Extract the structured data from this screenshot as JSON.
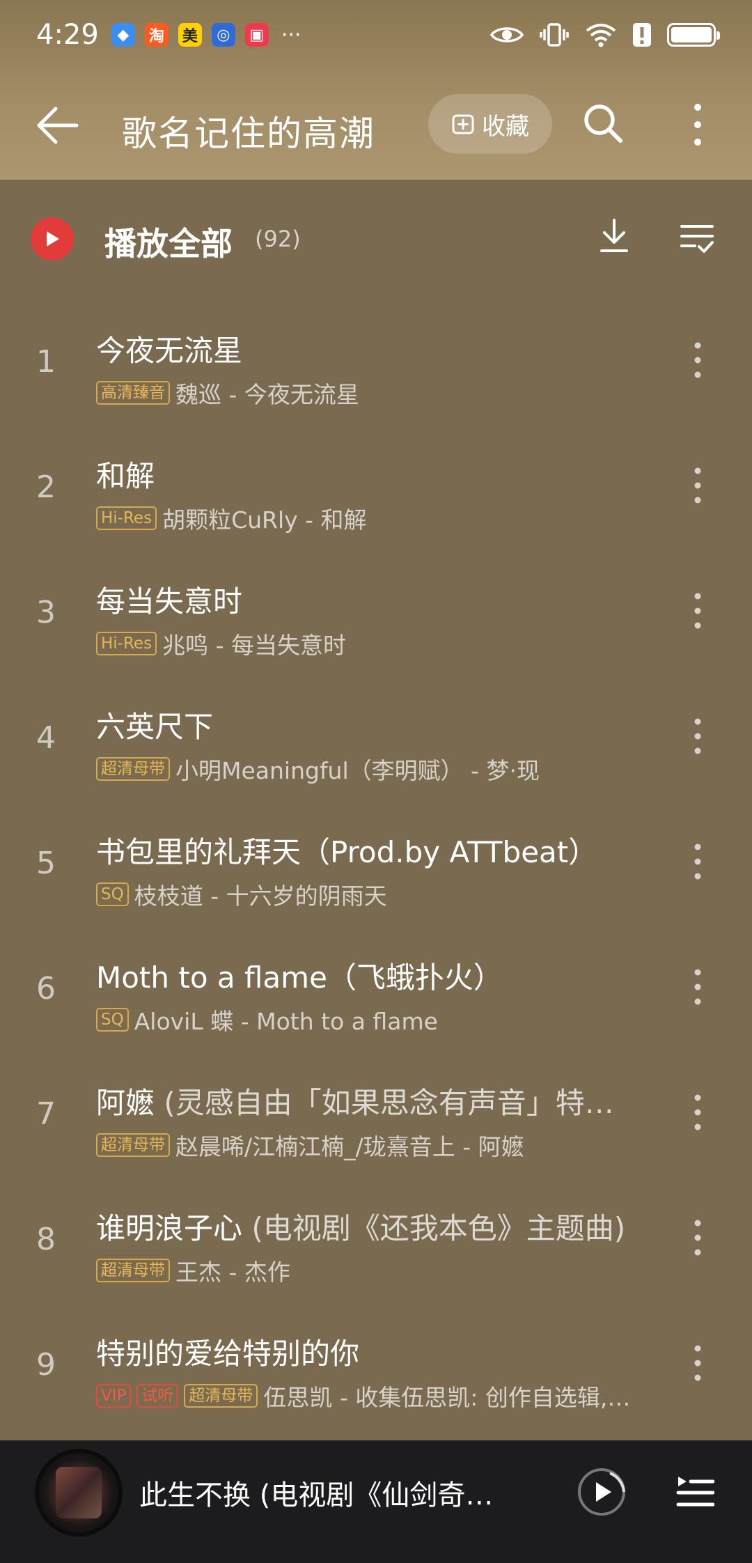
{
  "status_bar": {
    "time": "4:29",
    "notifications": [
      {
        "icon": "app-icon-blue",
        "color": "#3b8ef0",
        "glyph": "◆"
      },
      {
        "icon": "taobao-icon",
        "color": "#ff5a1f",
        "glyph": "淘"
      },
      {
        "icon": "meituan-icon",
        "color": "#ffd100",
        "glyph": "美"
      },
      {
        "icon": "app-icon-lightbulb",
        "color": "#2f6bd8",
        "glyph": "◎"
      },
      {
        "icon": "app-icon-red",
        "color": "#ee3a4a",
        "glyph": "▣"
      }
    ],
    "more": "···"
  },
  "header": {
    "title": "歌名记住的高潮",
    "favorite_label": "收藏"
  },
  "play_all": {
    "label": "播放全部",
    "count": "(92)"
  },
  "songs": [
    {
      "num": "1",
      "title": "今夜无流星",
      "title_sub": "",
      "badges": [
        {
          "text": "高清臻音",
          "kind": "quality"
        }
      ],
      "meta": "魏巡 - 今夜无流星"
    },
    {
      "num": "2",
      "title": "和解",
      "title_sub": "",
      "badges": [
        {
          "text": "Hi-Res",
          "kind": "quality"
        }
      ],
      "meta": "胡颗粒CuRly - 和解"
    },
    {
      "num": "3",
      "title": "每当失意时",
      "title_sub": "",
      "badges": [
        {
          "text": "Hi-Res",
          "kind": "quality"
        }
      ],
      "meta": "兆鸣 - 每当失意时"
    },
    {
      "num": "4",
      "title": "六英尺下",
      "title_sub": "",
      "badges": [
        {
          "text": "超清母带",
          "kind": "quality"
        }
      ],
      "meta": "小明Meaningful（李明赋） - 梦·现"
    },
    {
      "num": "5",
      "title": "书包里的礼拜天（Prod.by ATTbeat）",
      "title_sub": "",
      "badges": [
        {
          "text": "SQ",
          "kind": "quality"
        }
      ],
      "meta": "枝枝道 - 十六岁的阴雨天"
    },
    {
      "num": "6",
      "title": "Moth to a flame（飞蛾扑火）",
      "title_sub": "",
      "badges": [
        {
          "text": "SQ",
          "kind": "quality"
        }
      ],
      "meta": "AloviL 蝶 - Moth to a flame"
    },
    {
      "num": "7",
      "title": "阿嬷",
      "title_sub": " (灵感自由「如果思念有声音」特…",
      "badges": [
        {
          "text": "超清母带",
          "kind": "quality"
        }
      ],
      "meta": "赵晨唏/江楠江楠_/珑熹音上 - 阿嬷"
    },
    {
      "num": "8",
      "title": "谁明浪子心",
      "title_sub": " (电视剧《还我本色》主题曲)",
      "badges": [
        {
          "text": "超清母带",
          "kind": "quality"
        }
      ],
      "meta": "王杰 - 杰作"
    },
    {
      "num": "9",
      "title": "特别的爱给特别的你",
      "title_sub": "",
      "badges": [
        {
          "text": "VIP",
          "kind": "vip"
        },
        {
          "text": "试听",
          "kind": "trial"
        },
        {
          "text": "超清母带",
          "kind": "quality"
        }
      ],
      "meta": "伍思凯 - 收集伍思凯: 创作自选辑,…"
    }
  ],
  "now_playing": {
    "title": "此生不换 (电视剧《仙剑奇…"
  }
}
